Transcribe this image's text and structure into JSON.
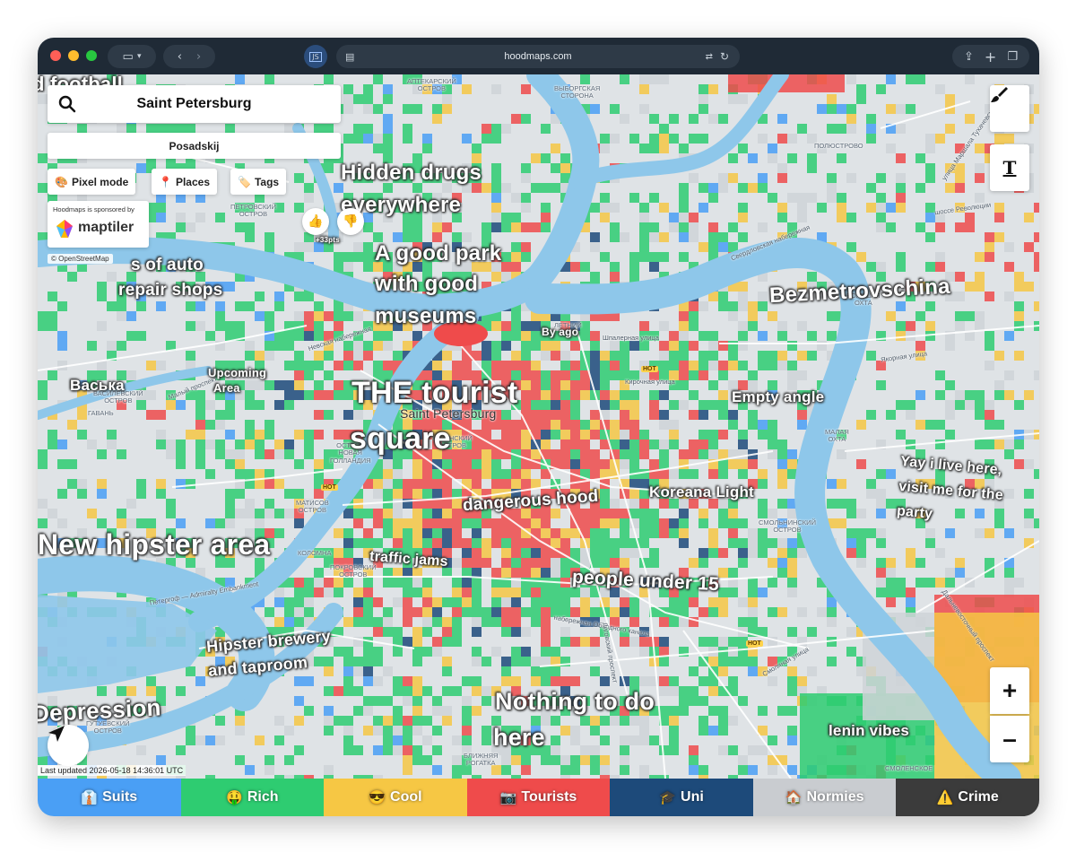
{
  "browser": {
    "url": "hoodmaps.com"
  },
  "search": {
    "value": "Saint Petersburg"
  },
  "hood": {
    "name": "Posadskij"
  },
  "chips": [
    {
      "label": "Pixel mode",
      "icon": "palette-icon"
    },
    {
      "label": "Places",
      "icon": "pin-icon"
    },
    {
      "label": "Tags",
      "icon": "tag-icon"
    }
  ],
  "sponsor": {
    "text": "Hoodmaps is sponsored by",
    "brand": "maptiler"
  },
  "attribution": "© OpenStreetMap",
  "vote": {
    "points": "+33pts"
  },
  "labels": [
    {
      "text": "d football",
      "size": 22
    },
    {
      "text": "Hidden drugs",
      "size": 24
    },
    {
      "text": "everywhere",
      "size": 24
    },
    {
      "text": "A good park",
      "size": 24
    },
    {
      "text": "with good",
      "size": 24
    },
    {
      "text": "museums",
      "size": 24
    },
    {
      "text": "s of auto",
      "size": 19
    },
    {
      "text": "repair shops",
      "size": 19
    },
    {
      "text": "By ago",
      "size": 12
    },
    {
      "text": "Bezmetrovschina",
      "size": 24
    },
    {
      "text": "Васька",
      "size": 17
    },
    {
      "text": "Upcoming",
      "size": 13
    },
    {
      "text": "Area",
      "size": 13
    },
    {
      "text": "THE tourist",
      "size": 34
    },
    {
      "text": "square",
      "size": 34
    },
    {
      "text": "Empty angle",
      "size": 17
    },
    {
      "text": "Yay i live here,",
      "size": 16
    },
    {
      "text": "visit me for the",
      "size": 16
    },
    {
      "text": "party",
      "size": 16
    },
    {
      "text": "dangerous hood",
      "size": 19
    },
    {
      "text": "Koreana Light",
      "size": 17
    },
    {
      "text": "New hipster area",
      "size": 32
    },
    {
      "text": "traffic jams",
      "size": 16
    },
    {
      "text": "people under 15",
      "size": 21
    },
    {
      "text": "Hipster brewery",
      "size": 18
    },
    {
      "text": "and taproom",
      "size": 18
    },
    {
      "text": "Depression",
      "size": 26
    },
    {
      "text": "Nothing to do",
      "size": 27
    },
    {
      "text": "here",
      "size": 27
    },
    {
      "text": "lenin vibes",
      "size": 17
    }
  ],
  "city_label": "Saint Petersburg",
  "districts": [
    "АПТЕКАРСКИЙ\nОСТРОВ",
    "ВЫБОРГСКАЯ\nСТОРОНА",
    "ПОЛЮСТРОВО",
    "ПЕТРОВСКИЙ\nОСТРОВ",
    "БОЛЬШАЯ\nОХТА",
    "ВАСИЛЕВСКИЙ\nОСТРОВ",
    "ГАВАНЬ",
    "ЛЕТНИЙ\nСАД",
    "КАЗАНСКИЙ\nОСТРОВ",
    "МАЛАЯ\nОХТА",
    "ОСТРОВ\nНОВАЯ\nГОЛЛАНДИЯ",
    "МАТИСОВ\nОСТРОВ",
    "КОЛОМНА",
    "ПОКРОВСКИЙ\nОСТРОВ",
    "СМОЛЬНИНСКИЙ\nОСТРОВ",
    "ГУТУЕВСКИЙ\nОСТРОВ",
    "БЛИЖНЯЯ\nРОГАТКА",
    "СМОЛЕНСКОЕ"
  ],
  "streets": [
    "Свердловская набережная",
    "шоссе Революции",
    "Шпалерная улица",
    "Кирочная улица",
    "Якорная улица",
    "Невская набережная",
    "Малый проспект",
    "Петергоф — Admiralty Embankment",
    "набережная Обводного канала",
    "Смоляная улица",
    "Лиговский проспект",
    "Дальневосточный проспект",
    "улица Маршала Тухачевского"
  ],
  "hot_badge": "HOT",
  "updated": "Last updated 2026-05-18 14:36:01 UTC",
  "zoom": {
    "in": "+",
    "out": "–"
  },
  "legend": [
    {
      "label": "Suits",
      "color": "#4a9ff5",
      "icon": "suit-icon",
      "glyph": "👔"
    },
    {
      "label": "Rich",
      "color": "#2ecc71",
      "icon": "money-face-icon",
      "glyph": "🤑"
    },
    {
      "label": "Cool",
      "color": "#f6c744",
      "icon": "sunglasses-icon",
      "glyph": "😎"
    },
    {
      "label": "Tourists",
      "color": "#ef4b4b",
      "icon": "camera-icon",
      "glyph": "📷"
    },
    {
      "label": "Uni",
      "color": "#1d4a7a",
      "icon": "graduation-cap-icon",
      "glyph": "🎓"
    },
    {
      "label": "Normies",
      "color": "#c9ccd0",
      "icon": "house-icon",
      "glyph": "🏠"
    },
    {
      "label": "Crime",
      "color": "#3b3b3b",
      "icon": "warning-icon",
      "glyph": "⚠️"
    }
  ]
}
